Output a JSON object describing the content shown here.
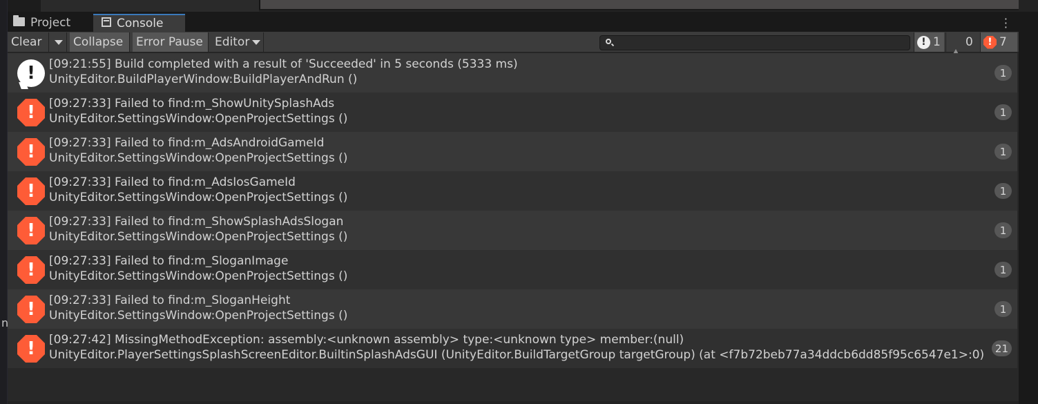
{
  "tabs": {
    "project_label": "Project",
    "console_label": "Console"
  },
  "toolbar": {
    "clear_label": "Clear",
    "collapse_label": "Collapse",
    "error_pause_label": "Error Pause",
    "editor_label": "Editor",
    "search_placeholder": "",
    "info_count": "1",
    "warning_count": "0",
    "error_count": "7"
  },
  "side": {
    "fragment": "n"
  },
  "log_entries": [
    {
      "type": "info",
      "line1": "[09:21:55] Build completed with a result of 'Succeeded' in 5 seconds (5333 ms)",
      "line2": "UnityEditor.BuildPlayerWindow:BuildPlayerAndRun ()",
      "count": "1"
    },
    {
      "type": "error",
      "line1": "[09:27:33] Failed to find:m_ShowUnitySplashAds",
      "line2": "UnityEditor.SettingsWindow:OpenProjectSettings ()",
      "count": "1"
    },
    {
      "type": "error",
      "line1": "[09:27:33] Failed to find:m_AdsAndroidGameId",
      "line2": "UnityEditor.SettingsWindow:OpenProjectSettings ()",
      "count": "1"
    },
    {
      "type": "error",
      "line1": "[09:27:33] Failed to find:m_AdsIosGameId",
      "line2": "UnityEditor.SettingsWindow:OpenProjectSettings ()",
      "count": "1"
    },
    {
      "type": "error",
      "line1": "[09:27:33] Failed to find:m_ShowSplashAdsSlogan",
      "line2": "UnityEditor.SettingsWindow:OpenProjectSettings ()",
      "count": "1"
    },
    {
      "type": "error",
      "line1": "[09:27:33] Failed to find:m_SloganImage",
      "line2": "UnityEditor.SettingsWindow:OpenProjectSettings ()",
      "count": "1"
    },
    {
      "type": "error",
      "line1": "[09:27:33] Failed to find:m_SloganHeight",
      "line2": "UnityEditor.SettingsWindow:OpenProjectSettings ()",
      "count": "1"
    },
    {
      "type": "error",
      "line1": "[09:27:42] MissingMethodException:  assembly:<unknown assembly> type:<unknown type> member:(null)",
      "line2": "UnityEditor.PlayerSettingsSplashScreenEditor.BuiltinSplashAdsGUI (UnityEditor.BuildTargetGroup targetGroup) (at <f7b72beb77a34ddcb6dd85f95c6547e1>:0)",
      "count": "21"
    }
  ],
  "colors": {
    "error_accent": "#fe5c37",
    "tab_accent": "#3a79bb"
  },
  "icons": {
    "info": "info-icon",
    "warning": "warning-icon",
    "error": "error-icon"
  }
}
